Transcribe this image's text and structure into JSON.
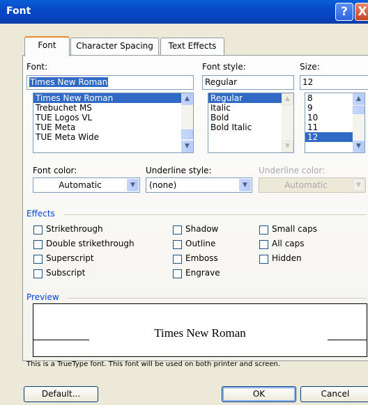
{
  "window": {
    "title": "Font",
    "help_label": "?",
    "close_label": "X"
  },
  "tabs": [
    {
      "label": "Font",
      "mnemonic": "n"
    },
    {
      "label": "Character Spacing",
      "mnemonic": "r"
    },
    {
      "label": "Text Effects",
      "mnemonic": "x"
    }
  ],
  "font": {
    "label": "Font:",
    "value": "Times New Roman",
    "items": [
      "Times New Roman",
      "Trebuchet MS",
      "TUE Logos VL",
      "TUE Meta",
      "TUE Meta Wide"
    ]
  },
  "style": {
    "label": "Font style:",
    "value": "Regular",
    "items": [
      "Regular",
      "Italic",
      "Bold",
      "Bold Italic"
    ]
  },
  "size": {
    "label": "Size:",
    "value": "12",
    "items": [
      "8",
      "9",
      "10",
      "11",
      "12"
    ]
  },
  "font_color": {
    "label": "Font color:",
    "value": "Automatic"
  },
  "underline_style": {
    "label": "Underline style:",
    "value": "(none)"
  },
  "underline_color": {
    "label": "Underline color:",
    "value": "Automatic"
  },
  "effects": {
    "title": "Effects",
    "col1": [
      "Strikethrough",
      "Double strikethrough",
      "Superscript",
      "Subscript"
    ],
    "col2": [
      "Shadow",
      "Outline",
      "Emboss",
      "Engrave"
    ],
    "col3": [
      "Small caps",
      "All caps",
      "Hidden"
    ]
  },
  "preview": {
    "title": "Preview",
    "text": "Times New Roman",
    "note": "This is a TrueType font. This font will be used on both printer and screen."
  },
  "buttons": {
    "default": "Default...",
    "ok": "OK",
    "cancel": "Cancel"
  },
  "colors": {
    "title_bar": "#0a5fd8",
    "selection": "#316ac5",
    "section_heading": "#0046d5",
    "active_tab_accent": "#e68b2c"
  }
}
